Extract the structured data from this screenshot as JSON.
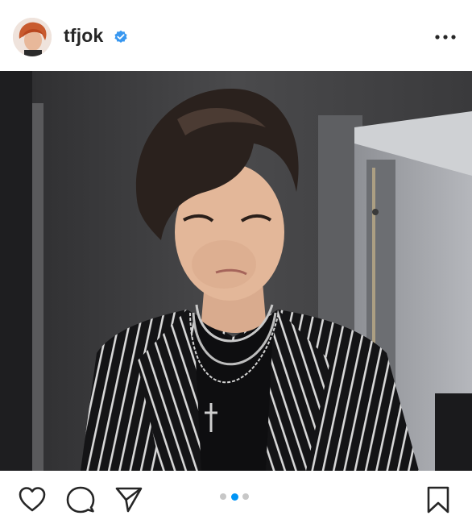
{
  "post": {
    "username": "tfjok",
    "verified": true,
    "more_icon": "more-horizontal-icon"
  },
  "carousel": {
    "total_slides": 3,
    "active_slide": 2,
    "active_color": "#0095f6",
    "inactive_color": "#c7c7c7"
  },
  "actions": {
    "like_icon": "heart-icon",
    "comment_icon": "comment-icon",
    "share_icon": "send-icon",
    "save_icon": "bookmark-icon"
  },
  "colors": {
    "verified_badge": "#3897f0",
    "text": "#262626"
  }
}
